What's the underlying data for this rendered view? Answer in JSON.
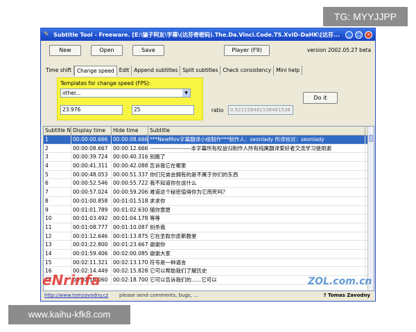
{
  "watermarks": {
    "top": "TG: MYYJJPP",
    "bottom": "www.kaihu-kfk8.com"
  },
  "window": {
    "title": "Subtitle Tool - Freeware. [E:\\骗子阿友\\字幕\\(达芬奇密码).The.Da.Vinci.Code.TS.XviD-DaHK\\[达芬...",
    "controls": [
      "minimize",
      "maximize",
      "close"
    ]
  },
  "toolbar": {
    "new_label": "New",
    "open_label": "Open",
    "save_label": "Save",
    "player_label": "Player (F9)",
    "version": "version  2002.05.27 beta"
  },
  "tabs": [
    "Time shift",
    "Change speed",
    "Edit",
    "Append subtitles",
    "Split subtitles",
    "Check consistency",
    "Mini help"
  ],
  "active_tab": "Change speed",
  "speed": {
    "templates_label": "Templates for change speed (FPS):",
    "template_value": "other...",
    "from_fps": "23.976",
    "to_fps": "25",
    "ratio_label": "ratio",
    "ratio_value": "0.922158461538461538",
    "do_it_label": "Do it"
  },
  "table": {
    "headers": [
      "Subtitle No",
      "Display time",
      "Hide time",
      "Subtitle"
    ],
    "rows": [
      [
        "1",
        "00:00:00.666",
        "00:00:08.666",
        "***NewMov字幕翻译小组制作***制作人：seonlady 所译校对：seonlady"
      ],
      [
        "2",
        "00:00:08.667",
        "00:00:12.666",
        "----------------------本字幕所有权益归制作人所有纯属翻译爱好者交流学习使用谢"
      ],
      [
        "3",
        "00:00:39.724",
        "00:00:40.316",
        "别跑了"
      ],
      [
        "4",
        "00:00:41.311",
        "00:00:42.088",
        "告诉我它在哪里"
      ],
      [
        "5",
        "00:00:48.053",
        "00:00:51.337",
        "你们兄弟会拥有的是不属于你们的东西"
      ],
      [
        "6",
        "00:00:52.546",
        "00:00:55.722",
        "我不知道你在说什么"
      ],
      [
        "7",
        "00:00:57.024",
        "00:00:59.206",
        "难道这个秘密值得你为它而死吗？"
      ],
      [
        "8",
        "00:01:00.858",
        "00:01:01.518",
        "求求你"
      ],
      [
        "9",
        "00:01:01.789",
        "00:01:02.630",
        "随你意愿"
      ],
      [
        "10",
        "00:01:03.492",
        "00:01:04.178",
        "等等"
      ],
      [
        "11",
        "00:01:08.777",
        "00:01:10.087",
        "别杀我"
      ],
      [
        "12",
        "00:01:12.646",
        "00:01:13.875",
        "它在圣叙尔皮斯教堂"
      ],
      [
        "13",
        "00:01:22.800",
        "00:01:23.667",
        "谢谢你"
      ],
      [
        "14",
        "00:01:59.406",
        "00:02:00.085",
        "谢谢大家"
      ],
      [
        "15",
        "00:02:11.321",
        "00:02:13.170",
        "符号是一种语言"
      ],
      [
        "16",
        "00:02:14.449",
        "00:02:15.828",
        "它可以帮助我们了解历史"
      ],
      [
        "17",
        "00:02:16.060",
        "00:02:18.700",
        "它可以告诉我们的......它可以"
      ]
    ],
    "selected_row": 0
  },
  "status": {
    "url": "http://www.tomzavodny.cz",
    "message": "please send comments, bugs, ...",
    "author": "? Tomas Zavodny"
  },
  "logos": {
    "left": "eNrinfa",
    "right": "ZOL.com.cn"
  },
  "colors": {
    "highlight": "#f8f442",
    "selection": "#316ac5",
    "titlebar": "#1f4fd0"
  }
}
